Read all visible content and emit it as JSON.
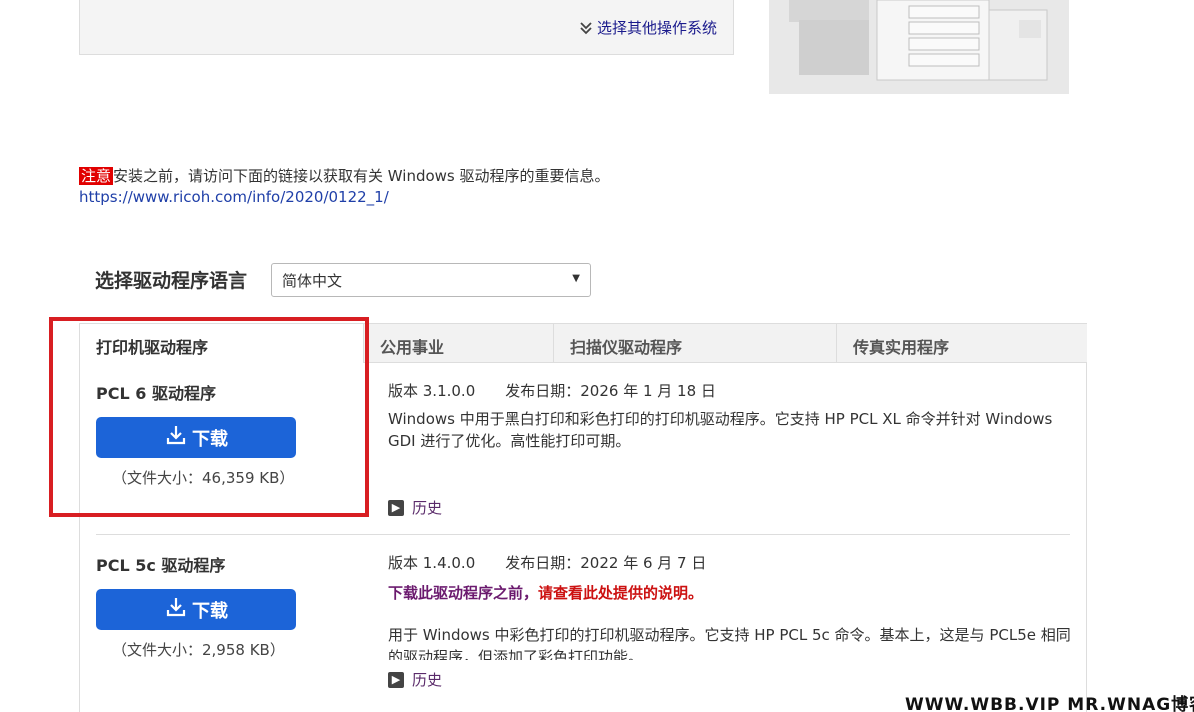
{
  "os_box": {
    "link_label": "选择其他操作系统"
  },
  "notice": {
    "tag": "注意",
    "text": "安装之前，请访问下面的链接以获取有关 Windows 驱动程序的重要信息。",
    "link": "https://www.ricoh.com/info/2020/0122_1/"
  },
  "language": {
    "label": "选择驱动程序语言",
    "selected": "简体中文"
  },
  "tabs": [
    {
      "label": "打印机驱动程序",
      "active": true
    },
    {
      "label": "公用事业",
      "active": false
    },
    {
      "label": "扫描仪驱动程序",
      "active": false
    },
    {
      "label": "传真实用程序",
      "active": false
    }
  ],
  "drivers": [
    {
      "name": "PCL 6 驱动程序",
      "download_label": "下载",
      "file_size": "（文件大小：46,359 KB）",
      "version": "版本 3.1.0.0",
      "release_date": "发布日期：2026 年 1 月 18 日",
      "description": "Windows 中用于黑白打印和彩色打印的打印机驱动程序。它支持 HP PCL XL 命令并针对 Windows GDI 进行了优化。高性能打印可期。",
      "history_label": "历史"
    },
    {
      "name": "PCL 5c 驱动程序",
      "download_label": "下载",
      "file_size": "（文件大小：2,958 KB）",
      "version": "版本 1.4.0.0",
      "release_date": "发布日期：2022 年 6 月 7 日",
      "warning_part1": "下载此驱动程序之前，",
      "warning_part2": "请查看此处提供的说明。",
      "description": "用于 Windows 中彩色打印的打印机驱动程序。它支持 HP PCL 5c 命令。基本上，这是与 PCL5e 相同的驱动程序，但添加了彩色打印功能。",
      "history_label": "历史"
    }
  ],
  "watermark": "WWW.WBB.VIP   MR.WNAG博客",
  "colors": {
    "primary_button": "#1c64d8",
    "highlight_box": "#d81e22",
    "notice_tag": "#e10000"
  }
}
